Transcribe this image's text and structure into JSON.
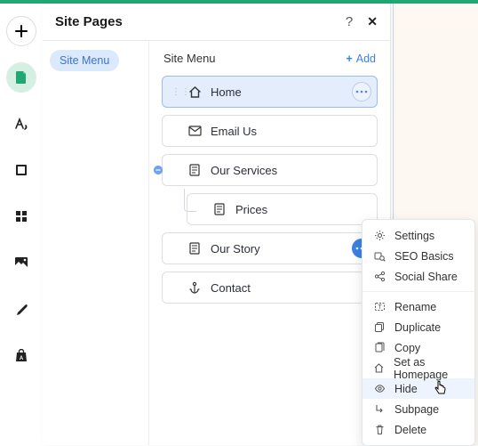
{
  "panel": {
    "title": "Site Pages",
    "help": "?",
    "close": "✕"
  },
  "sidebar": {
    "menu_label": "Site Menu"
  },
  "main": {
    "heading": "Site Menu",
    "add_label": "Add"
  },
  "pages": {
    "home": "Home",
    "email_us": "Email Us",
    "our_services": "Our Services",
    "prices": "Prices",
    "our_story": "Our Story",
    "contact": "Contact"
  },
  "context_menu": {
    "settings": "Settings",
    "seo": "SEO Basics",
    "social": "Social Share",
    "rename": "Rename",
    "duplicate": "Duplicate",
    "copy": "Copy",
    "homepage": "Set as Homepage",
    "hide": "Hide",
    "subpage": "Subpage",
    "delete": "Delete"
  }
}
